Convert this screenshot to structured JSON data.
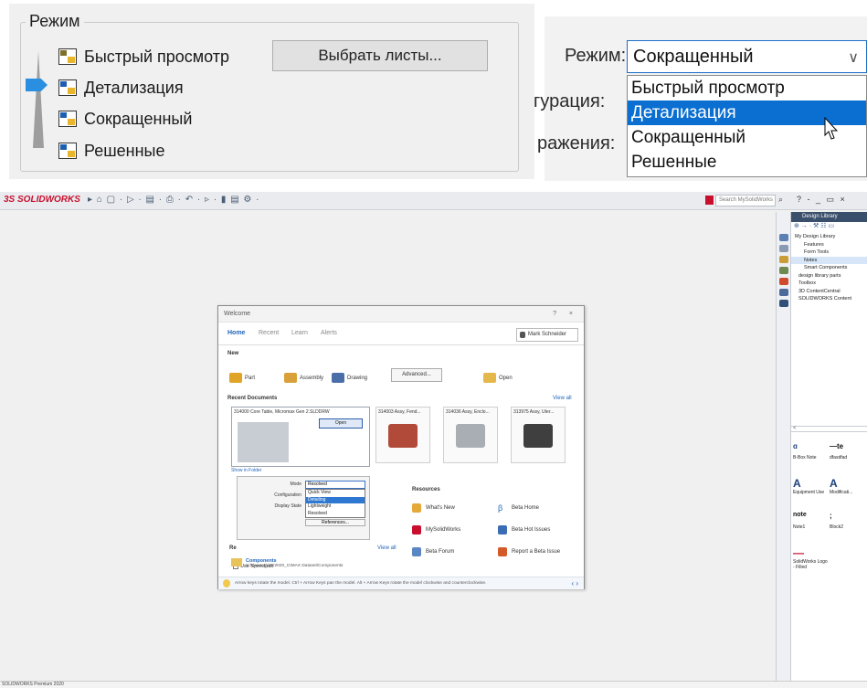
{
  "group_left": {
    "title": "Режим",
    "items": [
      "Быстрый просмотр",
      "Детализация",
      "Сокращенный",
      "Решенные"
    ],
    "select_sheets_button": "Выбрать листы..."
  },
  "combo_right": {
    "label_mode": "Режим:",
    "label_config_partial": "гурация:",
    "label_display_partial": "ражения:",
    "selected_value": "Сокращенный",
    "chevron": "∨",
    "options": [
      "Быстрый просмотр",
      "Детализация",
      "Сокращенный",
      "Решенные"
    ],
    "highlighted_option": "Детализация"
  },
  "sw": {
    "logo": "3S SOLIDWORKS",
    "quick_access": "▸ ⌂ ▢ · ▷ · ▤ · ⎙ · ↶ · ▹ · ▮ ▤ ⚙ ·",
    "search_placeholder": "Search MySolidWorks",
    "window_controls": "? - _ ▭ ×",
    "status_bar": "SOLIDWORKS Premium 2020",
    "task_pane": {
      "header": "Design Library",
      "toolbar": "⊕ → · ⚒ ☷ ▭",
      "tree": [
        "My Design Library",
        "Features",
        "Form Tools",
        "Notes",
        "Smart Components",
        "design library parts",
        "Toolbox",
        "3D ContentCentral",
        "SOLIDWORKS Content"
      ],
      "splitter": "<",
      "palette": [
        {
          "glyph": "ɑ",
          "label": "B-Box Note"
        },
        {
          "glyph": "—te",
          "label": "dfasdfad"
        },
        {
          "glyph": "A",
          "label": "Equipment Use"
        },
        {
          "glyph": "A",
          "label": "Modificati..."
        },
        {
          "glyph": "note",
          "label": "Note1"
        },
        {
          "glyph": ";",
          "label": "Block2"
        },
        {
          "glyph": "—",
          "label": "SolidWorks Logo - Filled"
        }
      ]
    },
    "welcome": {
      "title": "Welcome",
      "title_controls": "? ×",
      "tabs": [
        "Home",
        "Recent",
        "Learn",
        "Alerts"
      ],
      "user": "Mark Schneider",
      "new_label": "New",
      "new_items": [
        "Part",
        "Assembly",
        "Drawing"
      ],
      "advanced": "Advanced...",
      "open": "Open",
      "recent_docs_label": "Recent Documents",
      "view_all": "View all",
      "recent": [
        {
          "caption": "314000 Core Table, Micromax Gen 2.SLDDRW"
        },
        {
          "caption": "314003 Assy, Fend..."
        },
        {
          "caption": "314036 Assy, Enclo..."
        },
        {
          "caption": "313975 Assy, Uter..."
        }
      ],
      "open_button": "Open",
      "show_in_folder": "Show in Folder",
      "mode_label": "Mode",
      "configuration_label": "Configuration",
      "display_state_label": "Display State",
      "mode_value": "Resolved",
      "mode_options": [
        "Quick View",
        "Detailing",
        "Lightweight",
        "Resolved"
      ],
      "mode_highlight": "Detailing",
      "references": "References...",
      "recent_folders_partial": "Re",
      "view_all_2": "View all",
      "use_speedpak": "Use Speedpak",
      "resources_label": "Resources",
      "resources": [
        "What's New",
        "Beta Home",
        "MySolidWorks",
        "Beta Hot Issues",
        "Beta Forum",
        "Report a Beta Issue"
      ],
      "components_title": "Components",
      "components_path": "C:\\Seesoo\\SW2020_CIMAX Dataset\\Components",
      "tip": "Arrow keys rotate the model. Ctrl + Arrow Keys pan the model. Alt + Arrow Keys rotate the model clockwise and counterclockwise.",
      "tip_nav": "‹  ›"
    }
  }
}
